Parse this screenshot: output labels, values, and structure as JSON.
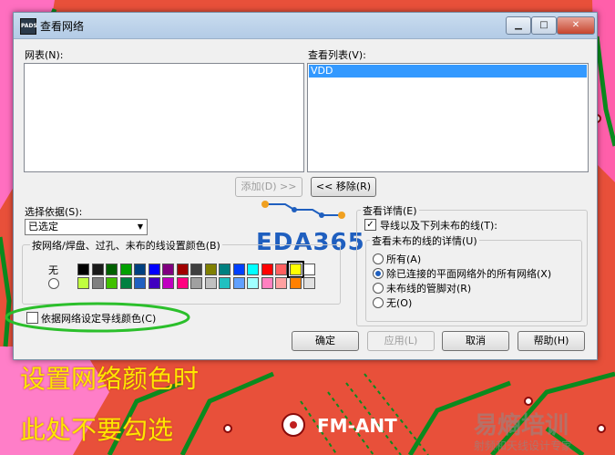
{
  "window": {
    "title": "查看网络",
    "icon_text": "PADS"
  },
  "nets_label": "网表(N):",
  "view_list_label": "查看列表(V):",
  "view_list_items": [
    "VDD"
  ],
  "buttons": {
    "add": "添加(D) >>",
    "remove": "<< 移除(R)",
    "ok": "确定",
    "apply": "应用(L)",
    "cancel": "取消",
    "help": "帮助(H)"
  },
  "select_by": {
    "label": "选择依据(S):",
    "value": "已选定"
  },
  "color_group": {
    "title": "按网络/焊盘、过孔、未布的线设置颜色(B)",
    "none_label": "无"
  },
  "colors": {
    "row1": [
      "#000000",
      "#1a1a1a",
      "#006000",
      "#00a000",
      "#004080",
      "#0000ff",
      "#800080",
      "#a00000",
      "#404040",
      "#808000",
      "#008080",
      "#0040ff",
      "#00ffff",
      "#ff0000",
      "#ff6060",
      "#ffff00",
      "#ffffff"
    ],
    "row2": [
      "#c0ff40",
      "#808080",
      "#40c000",
      "#008040",
      "#2060c0",
      "#4000c0",
      "#c000c0",
      "#ff0080",
      "#a0a0a0",
      "#c0c0c0",
      "#20c0c0",
      "#60a0ff",
      "#a0ffff",
      "#ff80c0",
      "#ffa0a0",
      "#ff8000",
      "#e0e0e0"
    ]
  },
  "net_color_checkbox": "依据网络设定导线颜色(C)",
  "details": {
    "title": "查看详情(E)",
    "show_unrouted": "导线以及下列未布的线(T):",
    "unrouted_group": "查看未布的线的详情(U)",
    "options": [
      "所有(A)",
      "除已连接的平面网络外的所有网络(X)",
      "未布线的管脚对(R)",
      "无(O)"
    ]
  },
  "logo": {
    "text": "EDA365"
  },
  "annotations": {
    "line1": "设置网络颜色时",
    "line2": "此处不要勾选"
  },
  "pcb_label": "FM-ANT",
  "watermark": {
    "line1": "易熵培训",
    "line2": "射频和天线设计专家"
  },
  "accent": "#3399ff"
}
